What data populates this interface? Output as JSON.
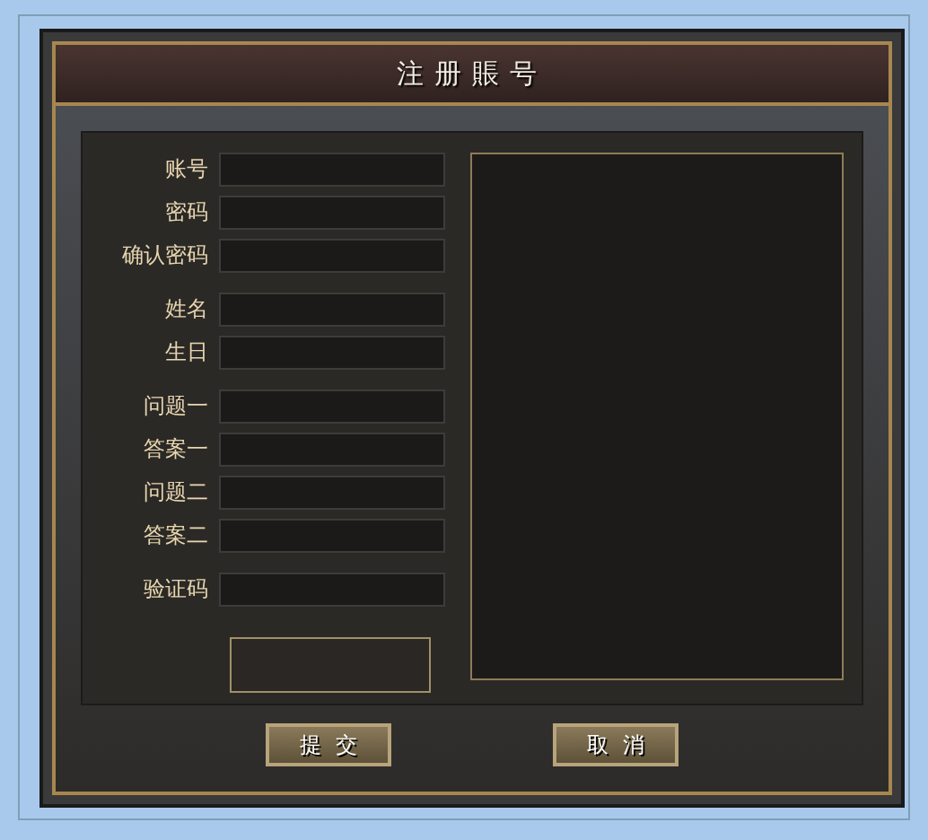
{
  "window": {
    "title": "注册賬号"
  },
  "form": {
    "groups": [
      {
        "fields": [
          {
            "label": "账号"
          },
          {
            "label": "密码"
          },
          {
            "label": "确认密码"
          }
        ]
      },
      {
        "fields": [
          {
            "label": "姓名"
          },
          {
            "label": "生日"
          }
        ]
      },
      {
        "fields": [
          {
            "label": "问题一"
          },
          {
            "label": "答案一"
          },
          {
            "label": "问题二"
          },
          {
            "label": "答案二"
          }
        ]
      },
      {
        "fields": [
          {
            "label": "验证码"
          }
        ]
      }
    ]
  },
  "buttons": [
    {
      "label": "提交"
    },
    {
      "label": "取消"
    }
  ]
}
